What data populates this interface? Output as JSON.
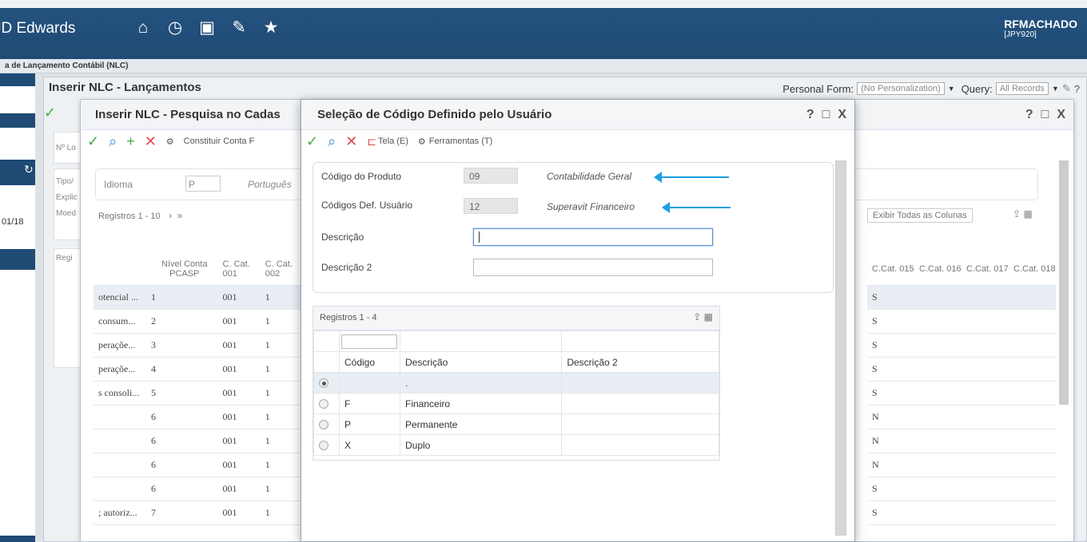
{
  "app": {
    "brand": "JD Edwards",
    "user": "RFMACHADO",
    "env": "[JPY920]"
  },
  "breadcrumb": "a de Lançamento Contábil (NLC)",
  "form1": {
    "title": "Inserir NLC - Lançamentos",
    "personal_form_label": "Personal Form:",
    "personal_form_value": "(No Personalization)",
    "query_label": "Query:",
    "query_value": "All Records"
  },
  "form2": {
    "title": "Inserir NLC - Pesquisa no Cadas",
    "toolbar_constituir": "Constituir Conta F",
    "idioma_label": "Idioma",
    "idioma_value": "P",
    "idioma_desc": "Português",
    "registros": "Registros 1 - 10",
    "exibir": "Exibir Todas as Colunas",
    "cols": [
      "Nível Conta PCASP",
      "C. Cat. 001",
      "C. Cat. 002"
    ],
    "right_cols": [
      "C.Cat. 015",
      "C.Cat. 016",
      "C.Cat. 017",
      "C.Cat. 018"
    ],
    "rows": [
      {
        "a": "otencial ...",
        "n": "1",
        "c": "001",
        "d": "1",
        "s": "S"
      },
      {
        "a": "consum...",
        "n": "2",
        "c": "001",
        "d": "1",
        "s": "S"
      },
      {
        "a": "peraçõe...",
        "n": "3",
        "c": "001",
        "d": "1",
        "s": "S"
      },
      {
        "a": "peraçõe...",
        "n": "4",
        "c": "001",
        "d": "1",
        "s": "S"
      },
      {
        "a": "s consoli...",
        "n": "5",
        "c": "001",
        "d": "1",
        "s": "S"
      },
      {
        "a": "",
        "n": "6",
        "c": "001",
        "d": "1",
        "s": "N"
      },
      {
        "a": "",
        "n": "6",
        "c": "001",
        "d": "1",
        "s": "N"
      },
      {
        "a": "",
        "n": "6",
        "c": "001",
        "d": "1",
        "s": "N"
      },
      {
        "a": "",
        "n": "6",
        "c": "001",
        "d": "1",
        "s": "S"
      },
      {
        "a": "; autoriz...",
        "n": "7",
        "c": "001",
        "d": "1",
        "s": "S"
      }
    ]
  },
  "dialog": {
    "title": "Seleção de Código Definido pelo Usuário",
    "tela": "Tela (E)",
    "ferramentas": "Ferramentas (T)",
    "codigo_produto_label": "Código do Produto",
    "codigo_produto_value": "09",
    "codigo_produto_desc": "Contabilidade Geral",
    "codigos_def_label": "Códigos Def. Usuário",
    "codigos_def_value": "12",
    "codigos_def_desc": "Superavit Financeiro",
    "descricao_label": "Descrição",
    "descricao2_label": "Descrição 2",
    "registros": "Registros 1 - 4",
    "headers": [
      "Código",
      "Descrição",
      "Descrição 2"
    ],
    "rows": [
      {
        "code": "",
        "desc": ".",
        "desc2": ""
      },
      {
        "code": "F",
        "desc": "Financeiro",
        "desc2": ""
      },
      {
        "code": "P",
        "desc": "Permanente",
        "desc2": ""
      },
      {
        "code": "X",
        "desc": "Duplo",
        "desc2": ""
      }
    ]
  },
  "left": {
    "date": "01/18"
  },
  "colors": {
    "header": "#1f4b74",
    "accent_arrow": "#1aa0e0",
    "ok": "#4aa84a",
    "cancel": "#e04848"
  }
}
